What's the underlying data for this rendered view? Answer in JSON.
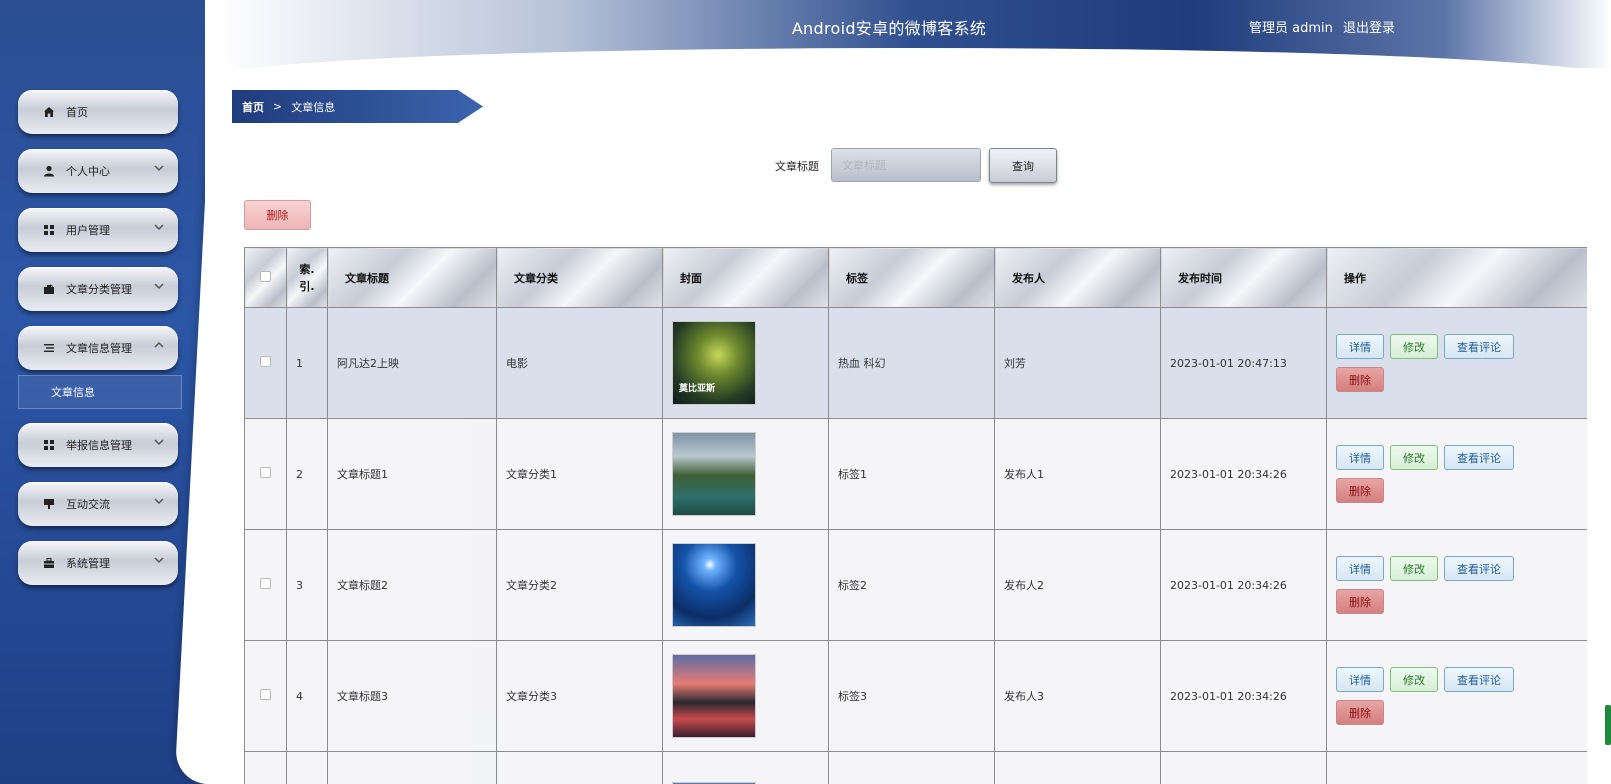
{
  "header": {
    "title": "Android安卓的微博客系统",
    "user_label": "管理员 admin",
    "logout_label": "退出登录"
  },
  "sidebar": {
    "items": [
      {
        "label": "首页",
        "icon": "home-icon",
        "has_chevron": false
      },
      {
        "label": "个人中心",
        "icon": "user-icon",
        "has_chevron": true
      },
      {
        "label": "用户管理",
        "icon": "grid-icon",
        "has_chevron": true
      },
      {
        "label": "文章分类管理",
        "icon": "briefcase-icon",
        "has_chevron": true
      },
      {
        "label": "文章信息管理",
        "icon": "list-icon",
        "has_chevron": true,
        "expanded": true
      },
      {
        "label": "举报信息管理",
        "icon": "grid-icon",
        "has_chevron": true
      },
      {
        "label": "互动交流",
        "icon": "chat-icon",
        "has_chevron": true
      },
      {
        "label": "系统管理",
        "icon": "toolbox-icon",
        "has_chevron": true
      }
    ],
    "sub_item": "文章信息"
  },
  "breadcrumb": {
    "home": "首页",
    "separator": ">",
    "current": "文章信息"
  },
  "search": {
    "label": "文章标题",
    "placeholder": "文章标题",
    "button": "查询"
  },
  "bulk_delete_label": "删除",
  "table": {
    "headers": {
      "index_top": "索.",
      "index_bottom": "引.",
      "title": "文章标题",
      "category": "文章分类",
      "cover": "封面",
      "tags": "标签",
      "publisher": "发布人",
      "time": "发布时间",
      "actions": "操作"
    },
    "rows": [
      {
        "index": "1",
        "title": "阿凡达2上映",
        "category": "电影",
        "tags": "热血 科幻",
        "publisher": "刘芳",
        "time": "2023-01-01 20:47:13",
        "cover_caption": "莫比亚斯"
      },
      {
        "index": "2",
        "title": "文章标题1",
        "category": "文章分类1",
        "tags": "标签1",
        "publisher": "发布人1",
        "time": "2023-01-01 20:34:26"
      },
      {
        "index": "3",
        "title": "文章标题2",
        "category": "文章分类2",
        "tags": "标签2",
        "publisher": "发布人2",
        "time": "2023-01-01 20:34:26"
      },
      {
        "index": "4",
        "title": "文章标题3",
        "category": "文章分类3",
        "tags": "标签3",
        "publisher": "发布人3",
        "time": "2023-01-01 20:34:26"
      }
    ],
    "actions": {
      "detail": "详情",
      "edit": "修改",
      "comments": "查看评论",
      "delete": "删除"
    }
  },
  "colors": {
    "sidebar": "#2c56a6",
    "header_dark": "#1f3c7c",
    "delete_text": "#b11a1a"
  }
}
